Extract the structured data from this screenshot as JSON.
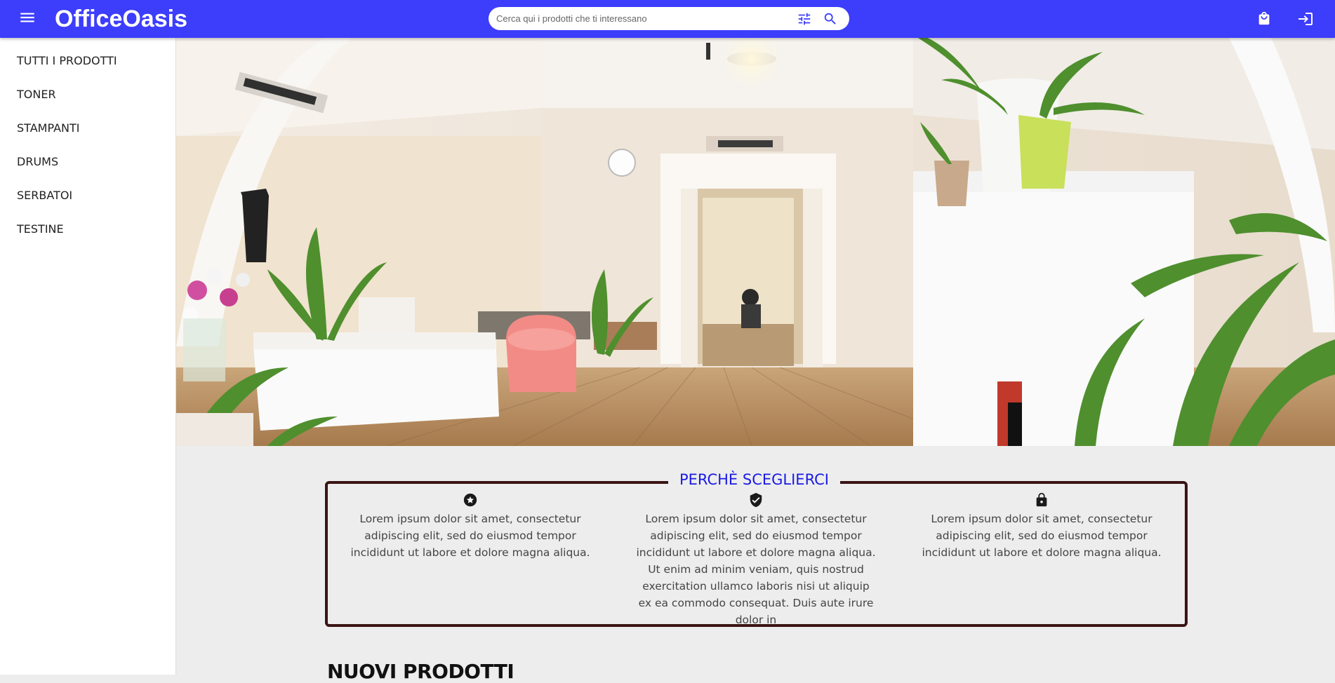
{
  "header": {
    "brand": "OfficeOasis",
    "search_placeholder": "Cerca qui i prodotti che ti interessano",
    "icons": [
      "menu-icon",
      "tune-icon",
      "search-icon",
      "shopping-bag-icon",
      "login-icon"
    ],
    "accent_color": "#3d3dfc"
  },
  "sidebar": {
    "items": [
      {
        "label": "TUTTI I PRODOTTI"
      },
      {
        "label": "TONER"
      },
      {
        "label": "STAMPANTI"
      },
      {
        "label": "DRUMS"
      },
      {
        "label": "SERBATOI"
      },
      {
        "label": "TESTINE"
      }
    ]
  },
  "why": {
    "title": "PERCHÈ SCEGLIERCI",
    "columns": [
      {
        "icon": "star-circle-icon",
        "text": "Lorem ipsum dolor sit amet, consectetur adipiscing elit, sed do eiusmod tempor incididunt ut labore et dolore magna aliqua."
      },
      {
        "icon": "shield-check-icon",
        "text": "Lorem ipsum dolor sit amet, consectetur adipiscing elit, sed do eiusmod tempor incididunt ut labore et dolore magna aliqua. Ut enim ad minim veniam, quis nostrud exercitation ullamco laboris nisi ut aliquip ex ea commodo consequat. Duis aute irure dolor in"
      },
      {
        "icon": "lock-icon",
        "text": "Lorem ipsum dolor sit amet, consectetur adipiscing elit, sed do eiusmod tempor incididunt ut labore et dolore magna aliqua."
      }
    ],
    "border_color": "#3a1414",
    "title_color": "#1a1ae6"
  },
  "new_products": {
    "title": "NUOVI PRODOTTI"
  }
}
